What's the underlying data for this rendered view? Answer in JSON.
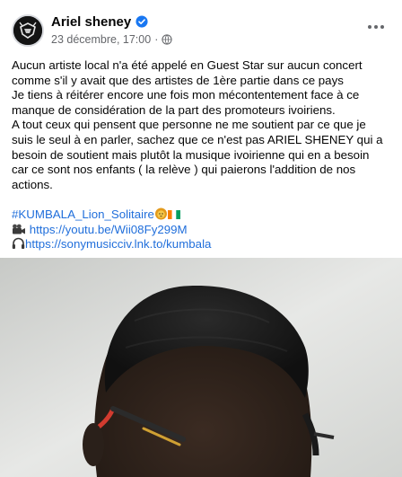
{
  "post": {
    "author": "Ariel sheney",
    "timestamp": "23 décembre, 17:00",
    "separator": "·",
    "audience_icon": "globe-icon",
    "verified_icon": "verified-badge-icon",
    "more_icon": "more-options-icon",
    "lines": [
      "Aucun artiste local n'a été appelé en Guest Star sur aucun concert",
      "comme s'il y avait que des artistes de 1ère partie dans ce pays",
      "Je tiens à réitérer encore une fois mon mécontentement face à ce",
      "manque de considération de la part des promoteurs ivoiriens.",
      "A tout ceux qui pensent que personne ne me soutient par ce que je",
      "suis le seul à en parler, sachez que  ce n'est pas ARIEL SHENEY qui a",
      "besoin de soutient mais plutôt la musique ivoirienne qui en a besoin",
      "car ce sont nos enfants ( la relève ) qui paierons l'addition de nos",
      "actions."
    ],
    "hashtag": "#KUMBALA_Lion_Solitaire",
    "youtube_link": "https://youtu.be/Wii08Fy299M",
    "music_link": "https://sonymusicciv.lnk.to/kumbala",
    "icons": {
      "hashtag_emojis": [
        "lion-emoji-icon",
        "ivory-coast-flag-icon"
      ],
      "youtube": "video-camera-icon",
      "music": "headphones-icon"
    }
  },
  "colors": {
    "link": "#216fdb",
    "meta": "#65676b",
    "verified": "#1877f2"
  }
}
